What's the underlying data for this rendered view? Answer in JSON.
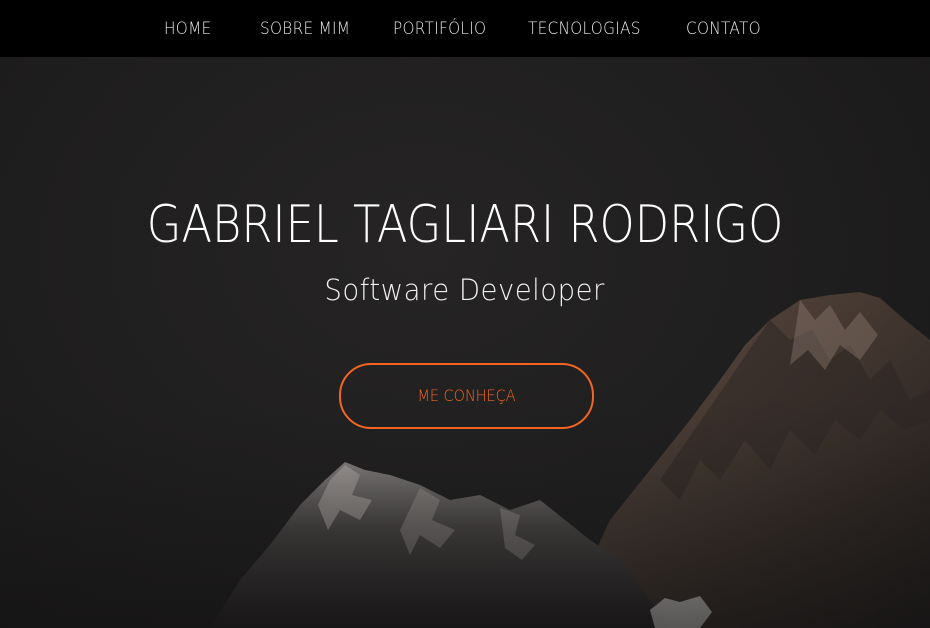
{
  "nav": {
    "items": [
      {
        "label": "HOME"
      },
      {
        "label": "SOBRE MIM"
      },
      {
        "label": "PORTIFÓLIO"
      },
      {
        "label": "TECNOLOGIAS"
      },
      {
        "label": "CONTATO"
      }
    ]
  },
  "hero": {
    "title": "GABRIEL TAGLIARI RODRIGO",
    "subtitle": "Software Developer",
    "cta_label": "ME CONHEÇA"
  },
  "colors": {
    "nav_bg": "#000000",
    "hero_bg": "#1f1e1e",
    "accent": "#f26522",
    "text": "#ffffff"
  },
  "icons": {
    "background": "mountain-peak-image"
  }
}
